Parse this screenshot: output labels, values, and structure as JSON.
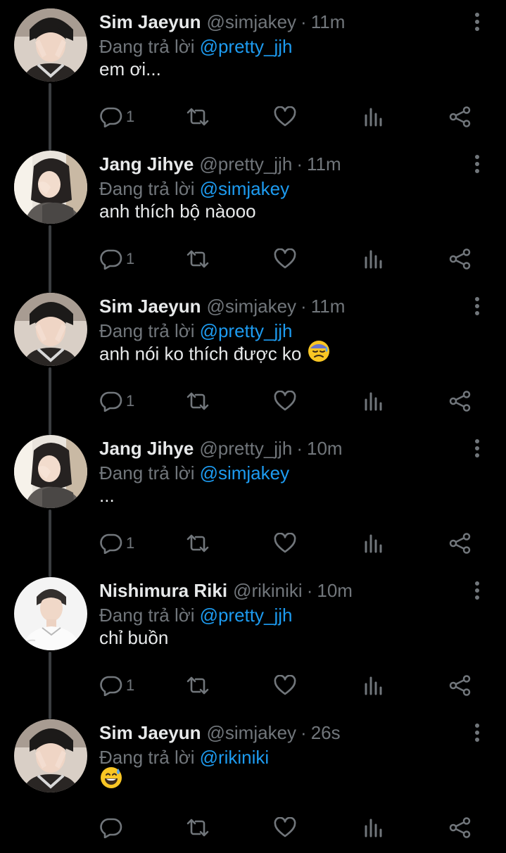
{
  "reply_prefix": "Đang trả lời",
  "colors": {
    "background": "#000000",
    "text_primary": "#e7e9ea",
    "text_secondary": "#71767b",
    "mention": "#1d9bf0",
    "thread_line": "#3a3d40"
  },
  "tweets": [
    {
      "name": "Sim Jaeyun",
      "handle": "@simjakey",
      "separator": "·",
      "time": "11m",
      "reply_to": "@pretty_jjh",
      "text": "em ơi...",
      "emoji": "",
      "reply_count": "1",
      "avatar": "sim-jaeyun-avatar"
    },
    {
      "name": "Jang Jihye",
      "handle": "@pretty_jjh",
      "separator": "·",
      "time": "11m",
      "reply_to": "@simjakey",
      "text": "anh thích bộ nàooo",
      "emoji": "",
      "reply_count": "1",
      "avatar": "jang-jihye-avatar"
    },
    {
      "name": "Sim Jaeyun",
      "handle": "@simjakey",
      "separator": "·",
      "time": "11m",
      "reply_to": "@pretty_jjh",
      "text": "anh nói ko thích được ko",
      "emoji": "sad-sweat-face-emoji",
      "reply_count": "1",
      "avatar": "sim-jaeyun-avatar"
    },
    {
      "name": "Jang Jihye",
      "handle": "@pretty_jjh",
      "separator": "·",
      "time": "10m",
      "reply_to": "@simjakey",
      "text": "...",
      "emoji": "",
      "reply_count": "1",
      "avatar": "jang-jihye-avatar"
    },
    {
      "name": "Nishimura Riki",
      "handle": "@rikiniki",
      "separator": "·",
      "time": "10m",
      "reply_to": "@pretty_jjh",
      "text": "chỉ buồn",
      "emoji": "",
      "reply_count": "1",
      "avatar": "nishimura-riki-avatar"
    },
    {
      "name": "Sim Jaeyun",
      "handle": "@simjakey",
      "separator": "·",
      "time": "26s",
      "reply_to": "@rikiniki",
      "text": "",
      "emoji": "grinning-sweat-face-emoji",
      "reply_count": "",
      "avatar": "sim-jaeyun-avatar"
    }
  ]
}
